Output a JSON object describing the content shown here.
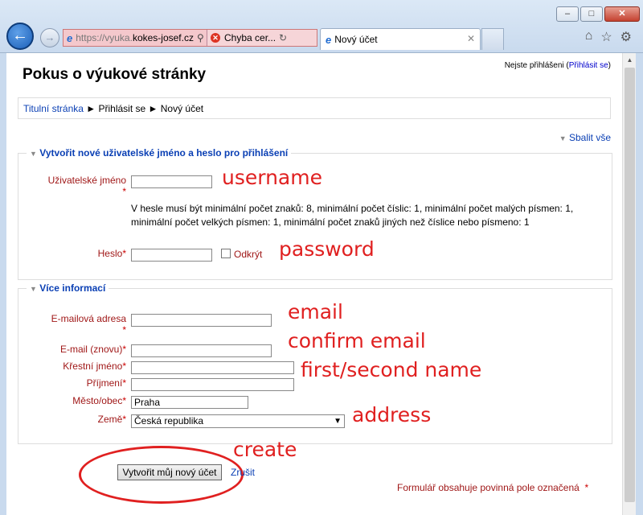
{
  "browser": {
    "url_prefix": "https://vyuka.",
    "url_domain": "kokes-josef.cz",
    "tab_error_title": "Chyba cer...",
    "active_tab_title": "Nový účet"
  },
  "page": {
    "title": "Pokus o výukové stránky",
    "login_status": "Nejste přihlášeni",
    "login_link": "Přihlásit se",
    "breadcrumb": [
      "Titulní stránka",
      "Přihlásit se",
      "Nový účet"
    ],
    "collapse_all": "Sbalit vše"
  },
  "section_account": {
    "legend": "Vytvořit nové uživatelské jméno a heslo pro přihlášení",
    "username_label": "Uživatelské jméno",
    "password_help": "V hesle musí být minimální počet znaků: 8, minimální počet číslic: 1, minimální počet malých písmen: 1, minimální počet velkých písmen: 1, minimální počet znaků jiných než číslice nebo písmeno: 1",
    "password_label": "Heslo",
    "unmask_label": "Odkrýt"
  },
  "section_more": {
    "legend": "Více informací",
    "email_label": "E-mailová adresa",
    "email2_label": "E-mail (znovu)",
    "firstname_label": "Křestní jméno",
    "lastname_label": "Příjmení",
    "city_label": "Město/obec",
    "city_value": "Praha",
    "country_label": "Země",
    "country_value": "Česká republika"
  },
  "actions": {
    "submit_label": "Vytvořit můj nový účet",
    "cancel_label": "Zrušit",
    "required_note": "Formulář obsahuje povinná pole označená"
  },
  "annotations": {
    "username": "username",
    "password": "password",
    "email": "email",
    "confirm_email": "confirm email",
    "name": "first/second name",
    "address": "address",
    "create": "create"
  },
  "colors": {
    "link": "#0a3fb4",
    "label": "#a01818",
    "annotation": "#e02020"
  }
}
